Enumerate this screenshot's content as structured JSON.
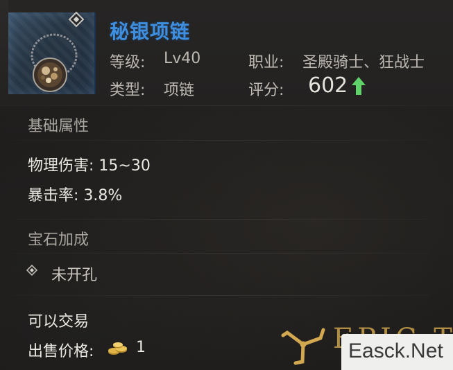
{
  "item": {
    "name": "秘银项链",
    "level_label": "等级:",
    "level_value": "Lv40",
    "class_label": "职业:",
    "class_value": "圣殿骑士、狂战士",
    "type_label": "类型:",
    "type_value": "项链",
    "score_label": "评分:",
    "score_value": "602",
    "score_trend": "up"
  },
  "sections": {
    "base_title": "基础属性",
    "stats": [
      "物理伤害: 15~30",
      "暴击率: 3.8%"
    ],
    "gem_title": "宝石加成",
    "gem_socket": "未开孔",
    "tradable": "可以交易",
    "price_label": "出售价格:",
    "price_value": "1"
  },
  "watermark": {
    "text": "EPIC TA",
    "site": "Easck.Net"
  },
  "colors": {
    "item_name": "#3e8fe0",
    "score_arrow": "#5fd36a",
    "gold": "#d4a53a"
  },
  "icons": {
    "item": "necklace-icon",
    "socket": "diamond-socket-icon",
    "currency": "gold-coin-icon",
    "trend": "up-arrow-icon"
  }
}
